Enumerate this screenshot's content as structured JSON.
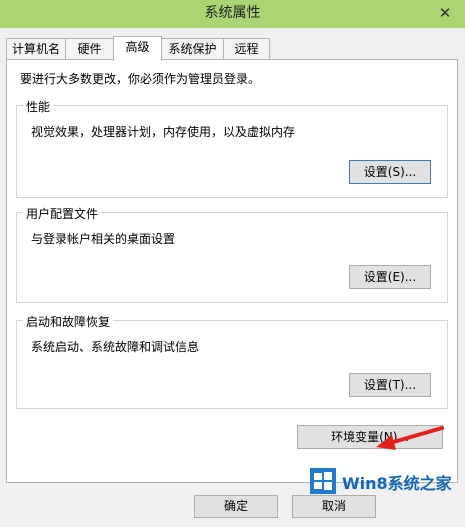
{
  "window": {
    "title": "系统属性",
    "close_glyph": "✕"
  },
  "tabs": [
    {
      "label": "计算机名"
    },
    {
      "label": "硬件"
    },
    {
      "label": "高级",
      "active": true
    },
    {
      "label": "系统保护"
    },
    {
      "label": "远程"
    }
  ],
  "note": "要进行大多数更改，你必须作为管理员登录。",
  "performance": {
    "title": "性能",
    "desc": "视觉效果，处理器计划，内存使用，以及虚拟内存",
    "button": "设置(S)..."
  },
  "profiles": {
    "title": "用户配置文件",
    "desc": "与登录帐户相关的桌面设置",
    "button": "设置(E)..."
  },
  "startup": {
    "title": "启动和故障恢复",
    "desc": "系统启动、系统故障和调试信息",
    "button": "设置(T)..."
  },
  "env_button": "环境变量(N)...",
  "footer": {
    "ok": "确定",
    "cancel": "取消"
  },
  "watermark": {
    "text": "Win8系统之家"
  },
  "colors": {
    "titlebar": "#a9d573",
    "arrow": "#e3201b",
    "logo": "#1b7bd1"
  }
}
